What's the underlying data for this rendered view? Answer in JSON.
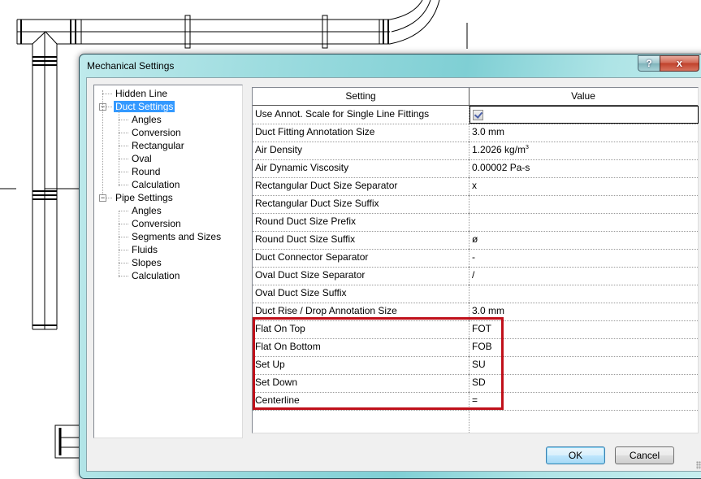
{
  "dialog": {
    "title": "Mechanical Settings",
    "help_label": "?",
    "close_label": "x"
  },
  "tree": {
    "items": [
      {
        "label": "Hidden Line",
        "level": 0,
        "selected": false
      },
      {
        "label": "Duct Settings",
        "level": 0,
        "selected": true,
        "expanded": true
      },
      {
        "label": "Angles",
        "level": 1
      },
      {
        "label": "Conversion",
        "level": 1
      },
      {
        "label": "Rectangular",
        "level": 1
      },
      {
        "label": "Oval",
        "level": 1
      },
      {
        "label": "Round",
        "level": 1
      },
      {
        "label": "Calculation",
        "level": 1
      },
      {
        "label": "Pipe Settings",
        "level": 0,
        "selected": false,
        "expanded": true
      },
      {
        "label": "Angles",
        "level": 1
      },
      {
        "label": "Conversion",
        "level": 1
      },
      {
        "label": "Segments and Sizes",
        "level": 1
      },
      {
        "label": "Fluids",
        "level": 1
      },
      {
        "label": "Slopes",
        "level": 1
      },
      {
        "label": "Calculation",
        "level": 1
      }
    ],
    "expander_glyph": "−"
  },
  "grid": {
    "columns": [
      "Setting",
      "Value"
    ],
    "rows": [
      {
        "setting": "Use Annot. Scale for Single Line Fittings",
        "value": "",
        "checkbox": true,
        "checked": true
      },
      {
        "setting": "Duct Fitting Annotation Size",
        "value": "3.0 mm"
      },
      {
        "setting": "Air Density",
        "value": "1.2026 kg/m",
        "value_sup": "3"
      },
      {
        "setting": "Air Dynamic Viscosity",
        "value": "0.00002 Pa-s"
      },
      {
        "setting": "Rectangular Duct Size Separator",
        "value": "x"
      },
      {
        "setting": "Rectangular Duct Size Suffix",
        "value": ""
      },
      {
        "setting": "Round Duct Size Prefix",
        "value": ""
      },
      {
        "setting": "Round Duct Size Suffix",
        "value": "ø"
      },
      {
        "setting": "Duct Connector Separator",
        "value": "-"
      },
      {
        "setting": "Oval Duct Size Separator",
        "value": "/"
      },
      {
        "setting": "Oval Duct Size Suffix",
        "value": ""
      },
      {
        "setting": "Duct Rise / Drop Annotation Size",
        "value": "3.0 mm"
      },
      {
        "setting": "Flat On Top",
        "value": "FOT",
        "highlighted": true
      },
      {
        "setting": "Flat On Bottom",
        "value": "FOB",
        "highlighted": true
      },
      {
        "setting": "Set Up",
        "value": "SU",
        "highlighted": true
      },
      {
        "setting": "Set Down",
        "value": "SD",
        "highlighted": true
      },
      {
        "setting": "Centerline",
        "value": "=",
        "highlighted": true
      }
    ]
  },
  "buttons": {
    "ok": "OK",
    "cancel": "Cancel"
  },
  "colors": {
    "highlight_box": "#c0101a",
    "tree_selection": "#3399ff",
    "title_bar": "#9fdde0"
  }
}
